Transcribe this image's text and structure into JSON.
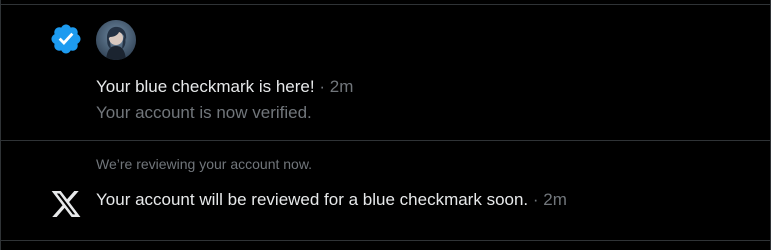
{
  "colors": {
    "background": "#000000",
    "text_primary": "#e7e9ea",
    "text_secondary": "#71767b",
    "divider": "#2f3336",
    "verified_blue": "#1d9bf0"
  },
  "notifications": [
    {
      "icon": "verified-badge-icon",
      "avatar": "user-avatar",
      "title": "Your blue checkmark is here!",
      "separator": "·",
      "time": "2m",
      "subtitle": "Your account is now verified."
    },
    {
      "icon": "x-logo-icon",
      "context": "We’re reviewing your account now.",
      "message": "Your account will be reviewed for a blue checkmark soon.",
      "separator": "·",
      "time": "2m"
    }
  ]
}
